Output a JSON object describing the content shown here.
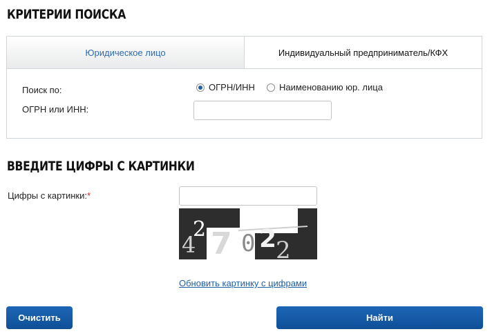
{
  "search": {
    "heading": "КРИТЕРИИ ПОИСКА",
    "tabs": [
      {
        "label": "Юридическое лицо",
        "active": true
      },
      {
        "label": "Индивидуальный предприниматель/КФХ",
        "active": false
      }
    ],
    "search_by_label": "Поиск по:",
    "radio_options": [
      {
        "label": "ОГРН/ИНН",
        "checked": true
      },
      {
        "label": "Наименованию юр. лица",
        "checked": false
      }
    ],
    "ogrn_label": "ОГРН или ИНН:",
    "ogrn_value": ""
  },
  "captcha": {
    "heading": "ВВЕДИТЕ ЦИФРЫ С КАРТИНКИ",
    "label": "Цифры с картинки:",
    "required_mark": "*",
    "value": "",
    "digits": "42702",
    "refresh_link": "Обновить картинку с цифрами"
  },
  "buttons": {
    "clear": "Очистить",
    "find": "Найти"
  },
  "colors": {
    "accent": "#1f5fa7",
    "button": "#155aa6",
    "required": "#d9271e",
    "border": "#cfd6dc"
  }
}
